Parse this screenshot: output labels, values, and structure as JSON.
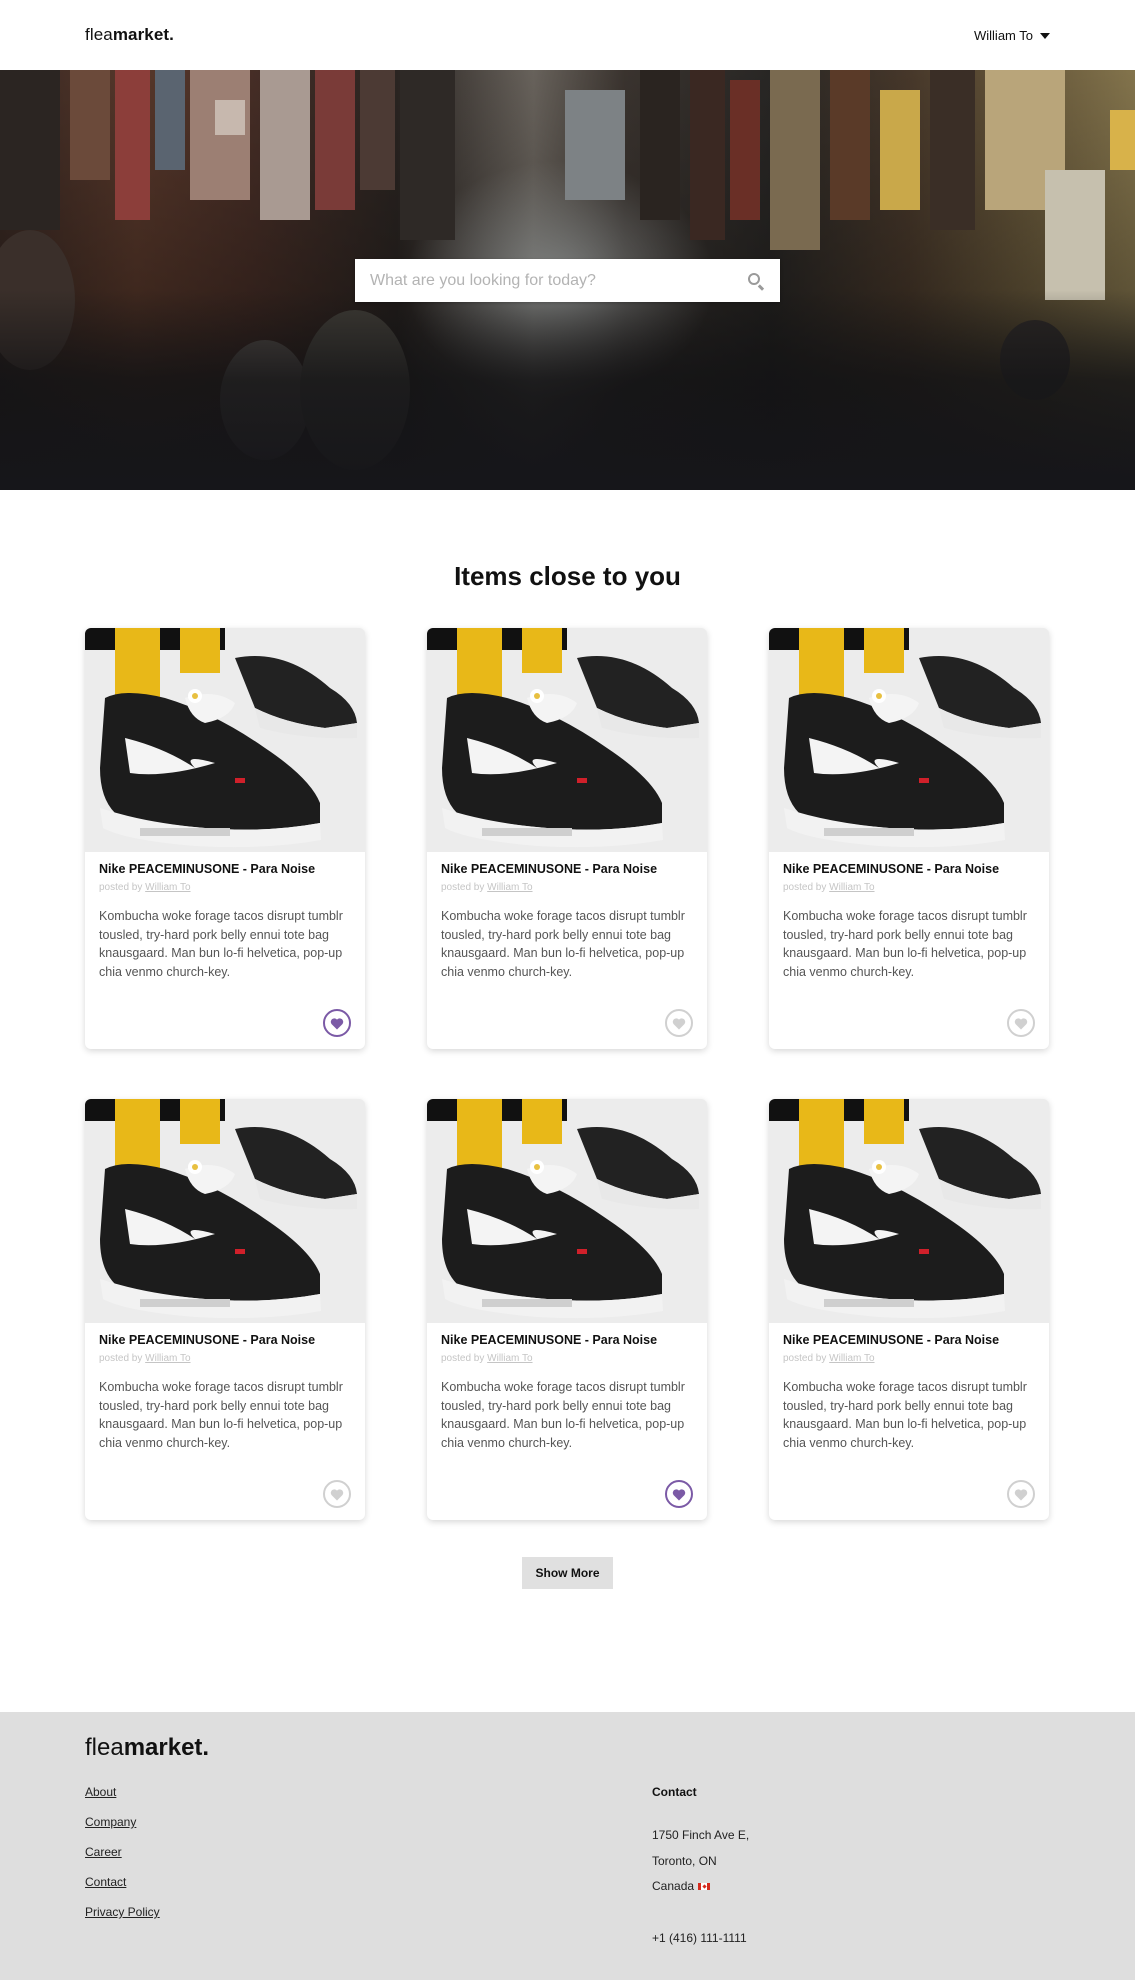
{
  "nav": {
    "logo_light": "flea",
    "logo_bold": "market.",
    "user_name": "William To"
  },
  "hero": {
    "search_placeholder": "What are you looking for today?",
    "search_icon": "search-icon"
  },
  "section": {
    "title": "Items close to you"
  },
  "items": [
    {
      "title": "Nike PEACEMINUSONE - Para Noise",
      "posted_by_prefix": "posted by",
      "author": "William To",
      "description": "Kombucha woke forage tacos disrupt tumblr tousled, try-hard pork belly ennui tote bag knausgaard. Man bun lo-fi helvetica, pop-up chia venmo church-key.",
      "favorited": true
    },
    {
      "title": "Nike PEACEMINUSONE - Para Noise",
      "posted_by_prefix": "posted by",
      "author": "William To",
      "description": "Kombucha woke forage tacos disrupt tumblr tousled, try-hard pork belly ennui tote bag knausgaard. Man bun lo-fi helvetica, pop-up chia venmo church-key.",
      "favorited": false
    },
    {
      "title": "Nike PEACEMINUSONE - Para Noise",
      "posted_by_prefix": "posted by",
      "author": "William To",
      "description": "Kombucha woke forage tacos disrupt tumblr tousled, try-hard pork belly ennui tote bag knausgaard. Man bun lo-fi helvetica, pop-up chia venmo church-key.",
      "favorited": false
    },
    {
      "title": "Nike PEACEMINUSONE - Para Noise",
      "posted_by_prefix": "posted by",
      "author": "William To",
      "description": "Kombucha woke forage tacos disrupt tumblr tousled, try-hard pork belly ennui tote bag knausgaard. Man bun lo-fi helvetica, pop-up chia venmo church-key.",
      "favorited": false
    },
    {
      "title": "Nike PEACEMINUSONE - Para Noise",
      "posted_by_prefix": "posted by",
      "author": "William To",
      "description": "Kombucha woke forage tacos disrupt tumblr tousled, try-hard pork belly ennui tote bag knausgaard. Man bun lo-fi helvetica, pop-up chia venmo church-key.",
      "favorited": true
    },
    {
      "title": "Nike PEACEMINUSONE - Para Noise",
      "posted_by_prefix": "posted by",
      "author": "William To",
      "description": "Kombucha woke forage tacos disrupt tumblr tousled, try-hard pork belly ennui tote bag knausgaard. Man bun lo-fi helvetica, pop-up chia venmo church-key.",
      "favorited": false
    }
  ],
  "show_more_label": "Show More",
  "footer": {
    "logo_light": "flea",
    "logo_bold": "market.",
    "links": [
      "About",
      "Company",
      "Career",
      "Contact",
      "Privacy Policy"
    ],
    "contact": {
      "heading": "Contact",
      "address_line1": "1750 Finch Ave E,",
      "address_line2": "Toronto, ON",
      "address_line3": "Canada",
      "phone": "+1 (416) 111-1111"
    }
  },
  "colors": {
    "accent_purple": "#7b5aa6",
    "heart_inactive": "#d0d0d0",
    "footer_bg": "#dedede",
    "button_bg": "#e0e0e0"
  }
}
